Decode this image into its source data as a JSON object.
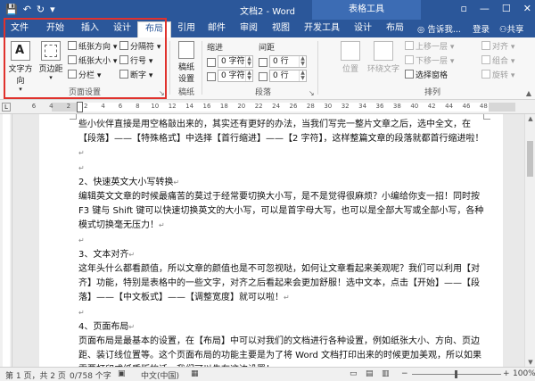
{
  "titlebar": {
    "title": "文档2 - Word",
    "contextual_tab_group": "表格工具",
    "qat_icons": [
      "save-icon",
      "undo-icon",
      "redo-icon",
      "customize-qat-icon"
    ],
    "window_controls": {
      "restore": "▫",
      "minimize": "—",
      "maximize": "☐",
      "close": "✕"
    }
  },
  "tabs": [
    {
      "label": "文件"
    },
    {
      "label": "开始"
    },
    {
      "label": "插入"
    },
    {
      "label": "设计"
    },
    {
      "label": "布局"
    },
    {
      "label": "引用"
    },
    {
      "label": "邮件"
    },
    {
      "label": "审阅"
    },
    {
      "label": "视图"
    },
    {
      "label": "开发工具"
    },
    {
      "label": "设计"
    },
    {
      "label": "布局"
    }
  ],
  "tab_right": {
    "tell_me": "告诉我...",
    "login": "登录",
    "share": "共享"
  },
  "ribbon": {
    "page_setup": {
      "group_label": "页面设置",
      "text_direction": "文字方向",
      "margins": "页边距",
      "orientation": "纸张方向",
      "size": "纸张大小",
      "columns": "分栏",
      "breaks": "分隔符",
      "line_numbers": "行号",
      "hyphenation": "断字"
    },
    "draft": {
      "line1": "稿纸",
      "line2": "设置",
      "group_label": "稿纸"
    },
    "paragraph": {
      "indent_header": "缩进",
      "spacing_header": "间距",
      "left_value": "0 字符",
      "right_value": "0 字符",
      "before_value": "0 行",
      "after_value": "0 行",
      "group_label": "段落"
    },
    "arrange": {
      "position": "位置",
      "wrap_text": "环绕文字",
      "bring_forward": "上移一层",
      "send_backward": "下移一层",
      "selection_pane": "选择窗格",
      "align": "对齐",
      "group": "组合",
      "rotate": "旋转",
      "group_label": "排列"
    }
  },
  "ruler_numbers": [
    "6",
    "4",
    "2",
    "2",
    "4",
    "6",
    "8",
    "10",
    "12",
    "14",
    "16",
    "18",
    "20",
    "22",
    "24",
    "26",
    "28",
    "30",
    "32",
    "34",
    "36",
    "38",
    "40",
    "42",
    "44",
    "46",
    "48"
  ],
  "document": {
    "paragraphs": [
      "些小伙伴直接是用空格敲出来的，其实还有更好的办法，当我们写完一整片文章之后，选中全文，在【段落】——【特殊格式】中选择【首行缩进】——【2 字符】，这样整篇文章的段落就都首行缩进啦！",
      "",
      "2、快速英文大小写转换",
      "编辑英文文章的时候最痛苦的莫过于经常要切换大小写，是不是觉得很麻烦？小编给你支一招！同时按F3 键与 Shift 键可以快速切换英文的大小写，可以是首字母大写，也可以是全部大写或全部小写，各种模式切换毫无压力！",
      "",
      "3、文本对齐",
      "这年头什么都看颜值，所以文章的颜值也是不可忽视哒，如何让文章看起来美观呢？我们可以利用【对齐】功能，特别是表格中的一些文字，对齐之后看起来会更加舒服！选中文本，点击【开始】——【段落】——【中文板式】——【调整宽度】就可以啦！",
      "",
      "4、页面布局",
      "页面布局是最基本的设置，在【布局】中可以对我们的文档进行各种设置，例如纸张大小、方向、页边距、装订线位置等。这个页面布局的功能主要是为了将 Word 文档打印出来的时候更加美观，所以如果需要打印成纸质版的话，我们可以先在这边设置！"
    ]
  },
  "statusbar": {
    "page": "第 1 页，共 2 页",
    "words": "0/758 个字",
    "language": "中文(中国)",
    "zoom": "100%"
  },
  "colors": {
    "accent": "#2b579a",
    "highlight": "#e0322d"
  }
}
